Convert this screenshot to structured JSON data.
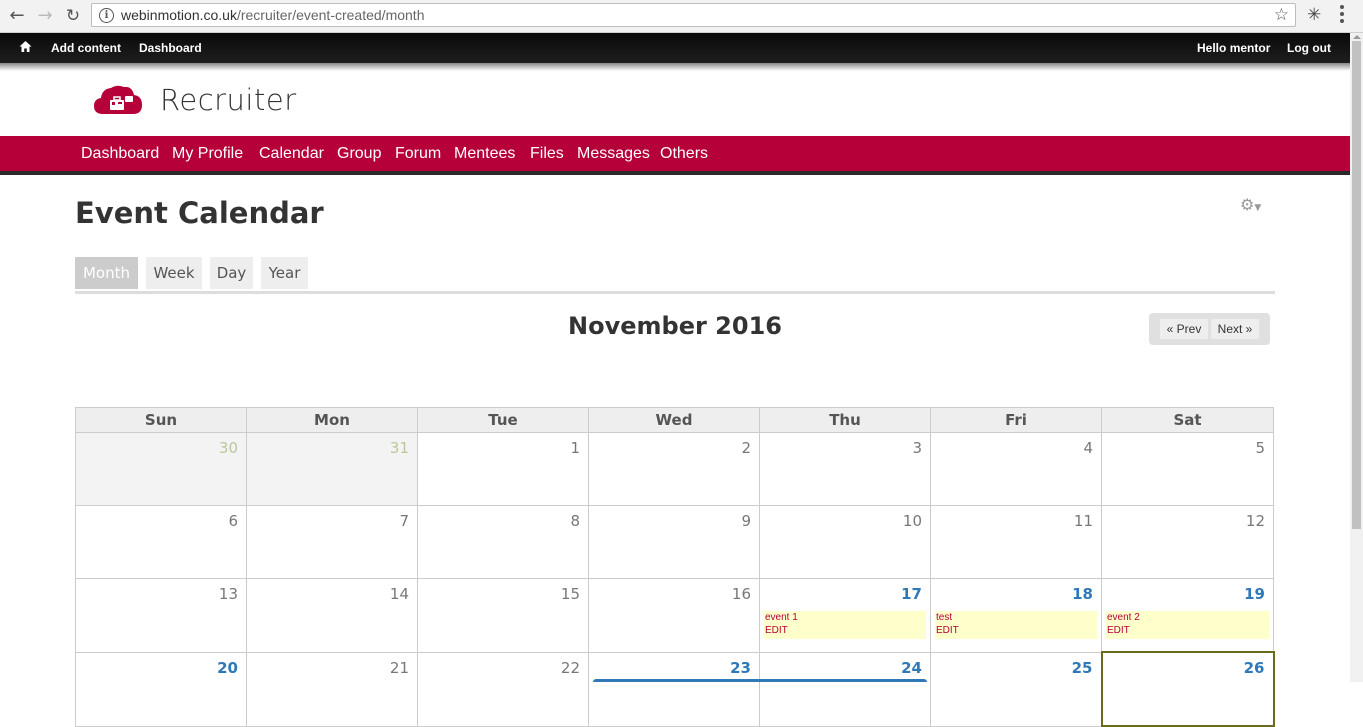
{
  "browser": {
    "url_host": "webinmotion.co.uk",
    "url_path": "/recruiter/event-created/month"
  },
  "toolbar": {
    "add_content": "Add content",
    "dashboard": "Dashboard",
    "hello": "Hello",
    "user": "mentor",
    "logout": "Log out"
  },
  "site": {
    "name": "Recruiter"
  },
  "mainnav": [
    "Dashboard",
    "My Profile",
    "Calendar",
    "Group",
    "Forum",
    "Mentees",
    "Files",
    "Messages",
    "Others"
  ],
  "page": {
    "title": "Event Calendar"
  },
  "tabs": [
    "Month",
    "Week",
    "Day",
    "Year"
  ],
  "calendar": {
    "month_title": "November 2016",
    "prev": "« Prev",
    "next": "Next »",
    "weekdays": [
      "Sun",
      "Mon",
      "Tue",
      "Wed",
      "Thu",
      "Fri",
      "Sat"
    ],
    "weeks": [
      [
        {
          "d": "30",
          "other": true
        },
        {
          "d": "31",
          "other": true
        },
        {
          "d": "1"
        },
        {
          "d": "2"
        },
        {
          "d": "3"
        },
        {
          "d": "4"
        },
        {
          "d": "5"
        }
      ],
      [
        {
          "d": "6"
        },
        {
          "d": "7"
        },
        {
          "d": "8"
        },
        {
          "d": "9"
        },
        {
          "d": "10"
        },
        {
          "d": "11"
        },
        {
          "d": "12"
        }
      ],
      [
        {
          "d": "13"
        },
        {
          "d": "14"
        },
        {
          "d": "15"
        },
        {
          "d": "16"
        },
        {
          "d": "17",
          "event": {
            "title": "event 1",
            "edit": "EDIT"
          }
        },
        {
          "d": "18",
          "event": {
            "title": "test",
            "edit": "EDIT"
          }
        },
        {
          "d": "19",
          "event": {
            "title": "event 2",
            "edit": "EDIT"
          }
        }
      ],
      [
        {
          "d": "20",
          "hl": true
        },
        {
          "d": "21"
        },
        {
          "d": "22"
        },
        {
          "d": "23",
          "hl": true
        },
        {
          "d": "24",
          "hl": true
        },
        {
          "d": "25",
          "hl": true
        },
        {
          "d": "26",
          "hl": true,
          "today": true
        }
      ]
    ]
  }
}
